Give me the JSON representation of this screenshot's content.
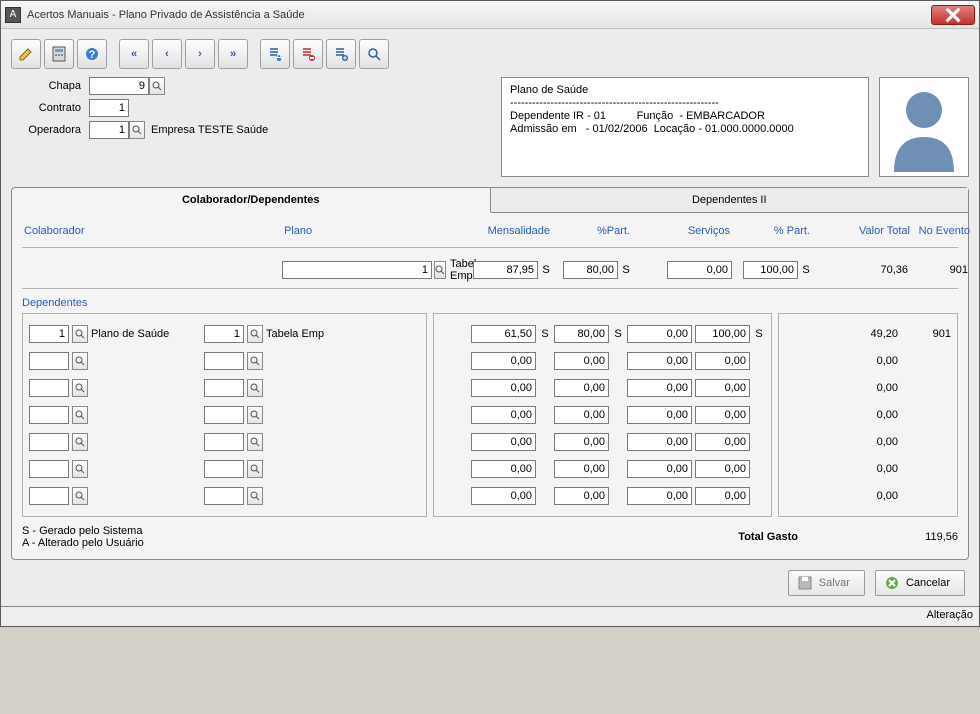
{
  "window": {
    "title": "Acertos Manuais - Plano Privado de Assistência a Saúde"
  },
  "fields": {
    "chapa_label": "Chapa",
    "chapa_value": "9",
    "contrato_label": "Contrato",
    "contrato_value": "1",
    "operadora_label": "Operadora",
    "operadora_value": "1",
    "operadora_desc": "Empresa TESTE Saúde"
  },
  "info_panel": {
    "line1": "Plano de Saúde",
    "line2": "---------------------------------------------------------",
    "line3": "Dependente IR - 01          Função  - EMBARCADOR",
    "line4": "Admissão em   - 01/02/2006  Locação - 01.000.0000.0000"
  },
  "tabs": {
    "t1": "Colaborador/Dependentes",
    "t2": "Dependentes II"
  },
  "grid_headers": {
    "colaborador": "Colaborador",
    "plano": "Plano",
    "mensalidade": "Mensalidade",
    "pct_part1": "%Part.",
    "servicos": "Serviços",
    "pct_part2": "% Part.",
    "valor_total": "Valor Total",
    "no_evento": "No Evento"
  },
  "colab_row": {
    "plano_code": "1",
    "plano_desc": "Tabela Emp",
    "mensalidade": "87,95",
    "mensalidade_flag": "S",
    "pct_part1": "80,00",
    "pct_part1_flag": "S",
    "servicos": "0,00",
    "pct_part2": "100,00",
    "pct_part2_flag": "S",
    "valor_total": "70,36",
    "no_evento": "901"
  },
  "dep_header": "Dependentes",
  "dep_rows": [
    {
      "code1": "1",
      "desc1": "Plano de Saúde",
      "code2": "1",
      "desc2": "Tabela Emp",
      "mensalidade": "61,50",
      "mens_flag": "S",
      "pct1": "80,00",
      "pct1_flag": "S",
      "serv": "0,00",
      "pct2": "100,00",
      "pct2_flag": "S",
      "total": "49,20",
      "evento": "901"
    },
    {
      "code1": "",
      "desc1": "",
      "code2": "",
      "desc2": "",
      "mensalidade": "0,00",
      "mens_flag": "",
      "pct1": "0,00",
      "pct1_flag": "",
      "serv": "0,00",
      "pct2": "0,00",
      "pct2_flag": "",
      "total": "0,00",
      "evento": ""
    },
    {
      "code1": "",
      "desc1": "",
      "code2": "",
      "desc2": "",
      "mensalidade": "0,00",
      "mens_flag": "",
      "pct1": "0,00",
      "pct1_flag": "",
      "serv": "0,00",
      "pct2": "0,00",
      "pct2_flag": "",
      "total": "0,00",
      "evento": ""
    },
    {
      "code1": "",
      "desc1": "",
      "code2": "",
      "desc2": "",
      "mensalidade": "0,00",
      "mens_flag": "",
      "pct1": "0,00",
      "pct1_flag": "",
      "serv": "0,00",
      "pct2": "0,00",
      "pct2_flag": "",
      "total": "0,00",
      "evento": ""
    },
    {
      "code1": "",
      "desc1": "",
      "code2": "",
      "desc2": "",
      "mensalidade": "0,00",
      "mens_flag": "",
      "pct1": "0,00",
      "pct1_flag": "",
      "serv": "0,00",
      "pct2": "0,00",
      "pct2_flag": "",
      "total": "0,00",
      "evento": ""
    },
    {
      "code1": "",
      "desc1": "",
      "code2": "",
      "desc2": "",
      "mensalidade": "0,00",
      "mens_flag": "",
      "pct1": "0,00",
      "pct1_flag": "",
      "serv": "0,00",
      "pct2": "0,00",
      "pct2_flag": "",
      "total": "0,00",
      "evento": ""
    },
    {
      "code1": "",
      "desc1": "",
      "code2": "",
      "desc2": "",
      "mensalidade": "0,00",
      "mens_flag": "",
      "pct1": "0,00",
      "pct1_flag": "",
      "serv": "0,00",
      "pct2": "0,00",
      "pct2_flag": "",
      "total": "0,00",
      "evento": ""
    }
  ],
  "legend": {
    "l1": "S - Gerado pelo Sistema",
    "l2": "A - Alterado pelo Usuário"
  },
  "totals": {
    "label": "Total Gasto",
    "value": "119,56"
  },
  "buttons": {
    "save": "Salvar",
    "cancel": "Cancelar"
  },
  "status": "Alteração",
  "icons": {
    "edit": "edit-icon",
    "calc": "calc-icon",
    "help": "help-icon",
    "first": "first-icon",
    "prev": "prev-icon",
    "next": "next-icon",
    "last": "last-icon",
    "tool1": "list-a-icon",
    "tool2": "list-minus-icon",
    "tool3": "list-plus-icon",
    "tool4": "search-icon"
  }
}
